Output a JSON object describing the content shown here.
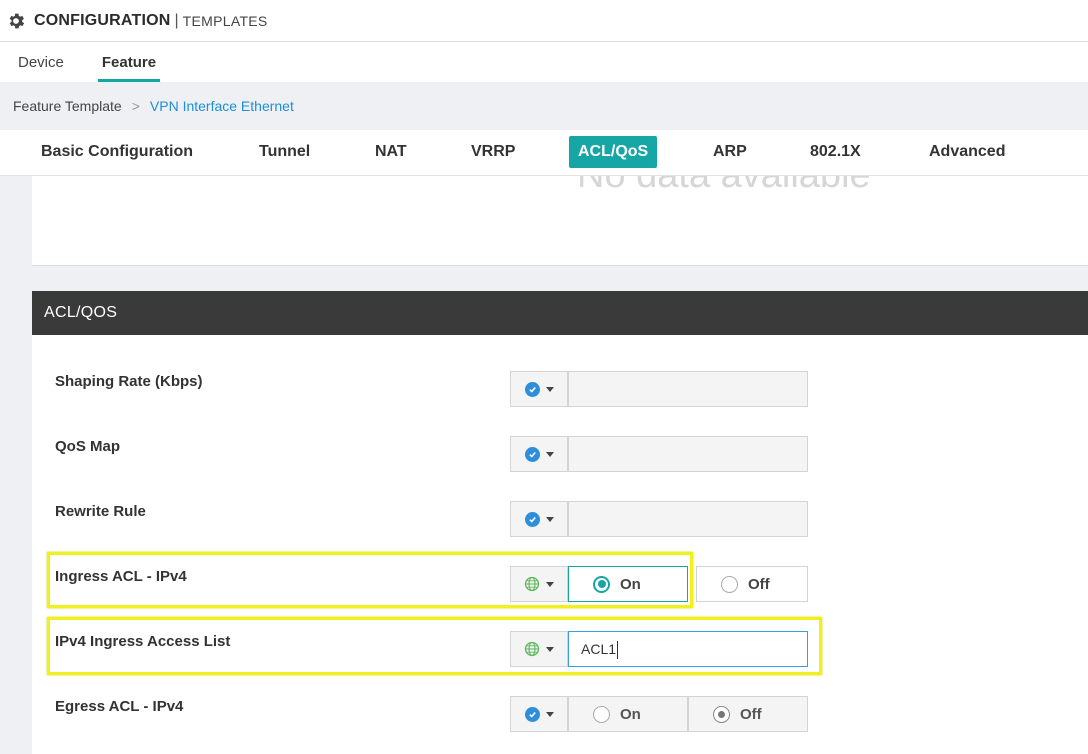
{
  "header": {
    "title": "CONFIGURATION",
    "separator": "|",
    "subtitle": "TEMPLATES"
  },
  "subtabs": [
    {
      "label": "Device",
      "active": false
    },
    {
      "label": "Feature",
      "active": true
    }
  ],
  "breadcrumb": {
    "parent": "Feature Template",
    "separator": ">",
    "current": "VPN Interface Ethernet"
  },
  "section_tabs": [
    {
      "label": "Basic Configuration"
    },
    {
      "label": "Tunnel"
    },
    {
      "label": "NAT"
    },
    {
      "label": "VRRP"
    },
    {
      "label": "ACL/QoS",
      "active": true
    },
    {
      "label": "ARP"
    },
    {
      "label": "802.1X"
    },
    {
      "label": "Advanced"
    }
  ],
  "empty_panel": {
    "message": "No data available"
  },
  "acl_section": {
    "title": "ACL/QOS",
    "rows": [
      {
        "label": "Shaping Rate (Kbps)",
        "scope": "default",
        "value": ""
      },
      {
        "label": "QoS Map",
        "scope": "default",
        "value": ""
      },
      {
        "label": "Rewrite Rule",
        "scope": "default",
        "value": ""
      },
      {
        "label": "Ingress ACL - IPv4",
        "scope": "global",
        "on_label": "On",
        "off_label": "Off",
        "selected": "On"
      },
      {
        "label": "IPv4 Ingress Access List",
        "scope": "global",
        "value": "ACL1"
      },
      {
        "label": "Egress ACL - IPv4",
        "scope": "default",
        "on_label": "On",
        "off_label": "Off",
        "selected": "Off"
      }
    ]
  },
  "colors": {
    "accent_teal": "#17a6a6",
    "link_blue": "#1e8fd6",
    "section_header": "#3a3a3a",
    "highlight": "#f0f01e"
  }
}
